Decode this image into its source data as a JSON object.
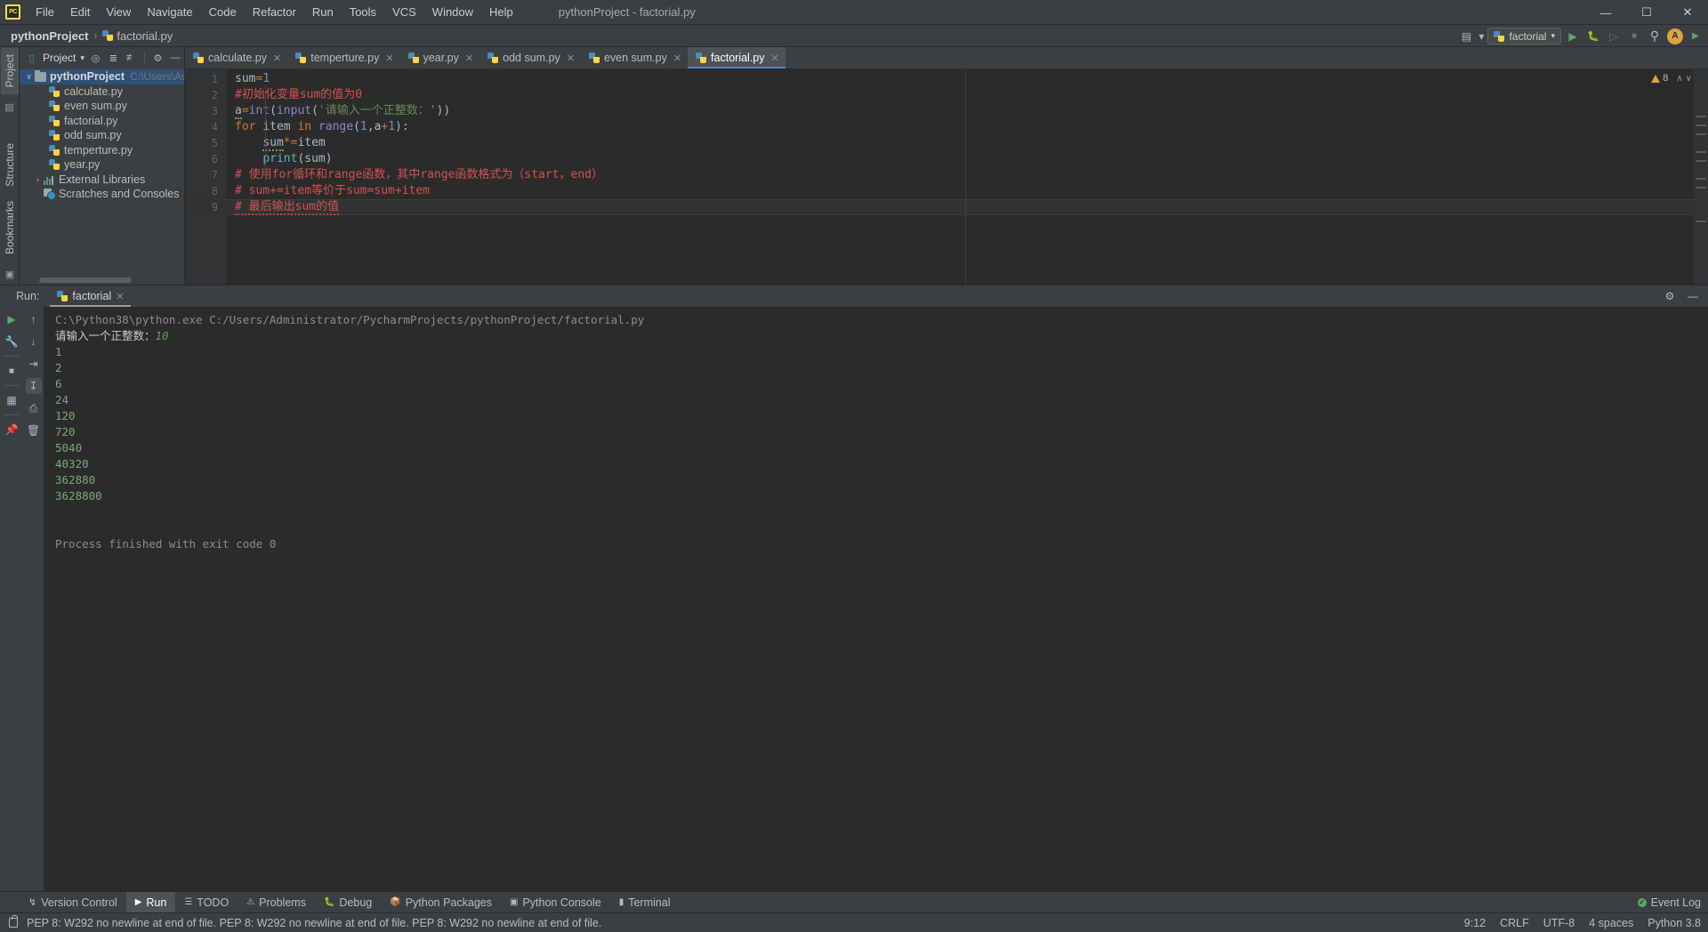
{
  "titlebar": {
    "logo": "PC",
    "menus": [
      "File",
      "Edit",
      "View",
      "Navigate",
      "Code",
      "Refactor",
      "Run",
      "Tools",
      "VCS",
      "Window",
      "Help"
    ],
    "title": "pythonProject - factorial.py",
    "minimize": "—",
    "maximize": "☐",
    "close": "✕"
  },
  "navbar": {
    "project": "pythonProject",
    "separator": "›",
    "file": "factorial.py",
    "run_config": "factorial",
    "run_config_caret": "▾",
    "icons": {
      "layout": "▤",
      "layout_caret": "▾",
      "run": "▶",
      "debug": "🐞",
      "run_coverage": "▷",
      "stop": "■",
      "search": "⌕",
      "avatar": "A",
      "updates": "▶"
    }
  },
  "left_strip": {
    "project_tab": "Project",
    "structure_tab": "Structure",
    "bookmarks_tab": "Bookmarks"
  },
  "project_panel": {
    "title": "Project",
    "title_caret": "▾",
    "header_icons": [
      "locate-icon",
      "expand-all-icon",
      "collapse-all-icon",
      "gear-icon",
      "hide-icon"
    ],
    "root": {
      "name": "pythonProject",
      "path": "C:\\Users\\Admini",
      "expand": "∨"
    },
    "files": [
      "calculate.py",
      "even sum.py",
      "factorial.py",
      "odd sum.py",
      "temperture.py",
      "year.py"
    ],
    "external_libraries": "External Libraries",
    "external_libraries_expand": "›",
    "scratches": "Scratches and Consoles"
  },
  "editor": {
    "tabs": [
      {
        "label": "calculate.py",
        "active": false
      },
      {
        "label": "temperture.py",
        "active": false
      },
      {
        "label": "year.py",
        "active": false
      },
      {
        "label": "odd sum.py",
        "active": false
      },
      {
        "label": "even sum.py",
        "active": false
      },
      {
        "label": "factorial.py",
        "active": true
      }
    ],
    "close_glyph": "✕",
    "warning_count": "8",
    "warning_caret_up": "∧",
    "warning_caret_down": "∨",
    "lines": [
      {
        "n": "1",
        "text": "sum=1"
      },
      {
        "n": "2",
        "text": "#初始化变量sum的值为0"
      },
      {
        "n": "3",
        "text": "a=int(input('请输入一个正整数：'))"
      },
      {
        "n": "4",
        "text": "for item in range(1,a+1):"
      },
      {
        "n": "5",
        "text": "    sum*=item"
      },
      {
        "n": "6",
        "text": "    print(sum)"
      },
      {
        "n": "7",
        "text": "# 使用for循环和range函数，其中range函数格式为（start，end）"
      },
      {
        "n": "8",
        "text": "# sum+=item等价于sum=sum+item"
      },
      {
        "n": "9",
        "text": "# 最后输出sum的值"
      }
    ]
  },
  "run_panel": {
    "label": "Run:",
    "tab": "factorial",
    "tab_close": "✕",
    "gear": "⚙",
    "hide": "—",
    "side_icons": [
      "rerun-icon",
      "settings-icon",
      "stop-icon",
      "layout-icon",
      "pin-icon"
    ],
    "side_icons2": [
      "up-arrow-icon",
      "down-arrow-icon",
      "soft-wrap-icon",
      "scroll-to-end-icon",
      "print-icon",
      "clear-all-icon"
    ],
    "console": [
      {
        "type": "cmd",
        "text": "C:\\Python38\\python.exe C:/Users/Administrator/PycharmProjects/pythonProject/factorial.py"
      },
      {
        "type": "prompt",
        "text": "请输入一个正整数：",
        "input": "10"
      },
      {
        "type": "out",
        "text": "1"
      },
      {
        "type": "out",
        "text": "2"
      },
      {
        "type": "out",
        "text": "6"
      },
      {
        "type": "out",
        "text": "24"
      },
      {
        "type": "out",
        "text": "120"
      },
      {
        "type": "out",
        "text": "720"
      },
      {
        "type": "out",
        "text": "5040"
      },
      {
        "type": "out",
        "text": "40320"
      },
      {
        "type": "out",
        "text": "362880"
      },
      {
        "type": "out",
        "text": "3628800"
      },
      {
        "type": "blank",
        "text": ""
      },
      {
        "type": "cmd",
        "text": "Process finished with exit code 0"
      }
    ]
  },
  "tool_window_bar": {
    "items": [
      {
        "label": "Version Control",
        "icon": "branch-icon",
        "active": false
      },
      {
        "label": "Run",
        "icon": "play-icon",
        "active": true
      },
      {
        "label": "TODO",
        "icon": "list-icon",
        "active": false
      },
      {
        "label": "Problems",
        "icon": "error-icon",
        "active": false
      },
      {
        "label": "Debug",
        "icon": "bug-icon",
        "active": false
      },
      {
        "label": "Python Packages",
        "icon": "package-icon",
        "active": false
      },
      {
        "label": "Python Console",
        "icon": "console-icon",
        "active": false
      },
      {
        "label": "Terminal",
        "icon": "terminal-icon",
        "active": false
      }
    ],
    "event_log": "Event Log"
  },
  "statusbar": {
    "message": "PEP 8: W292 no newline at end of file. PEP 8: W292 no newline at end of file. PEP 8: W292 no newline at end of file.",
    "position": "9:12",
    "line_sep": "CRLF",
    "encoding": "UTF-8",
    "indent": "4 spaces",
    "interpreter": "Python 3.8",
    "lock_icon": "lock-icon"
  },
  "colors": {
    "bg": "#3c3f41",
    "editor_bg": "#2b2b2b",
    "accent": "#4a88c7",
    "comment": "#d25252",
    "keyword": "#cc7832",
    "string": "#6a8759",
    "number": "#6897bb",
    "output": "#7ba77b",
    "selection": "#2f5178"
  }
}
